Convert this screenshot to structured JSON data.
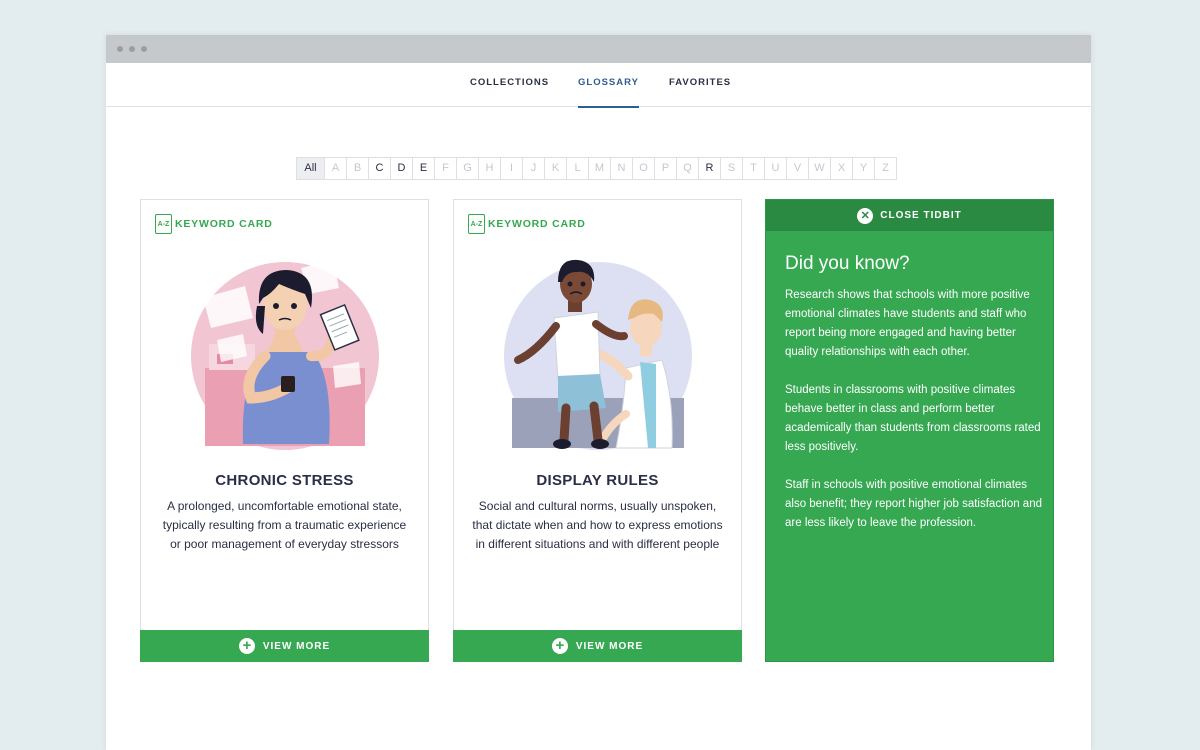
{
  "nav": {
    "tabs": [
      {
        "label": "COLLECTIONS",
        "active": false
      },
      {
        "label": "GLOSSARY",
        "active": true
      },
      {
        "label": "FAVORITES",
        "active": false
      }
    ]
  },
  "alphabet": {
    "all_label": "All",
    "letters": [
      {
        "l": "A",
        "on": false
      },
      {
        "l": "B",
        "on": false
      },
      {
        "l": "C",
        "on": true
      },
      {
        "l": "D",
        "on": true
      },
      {
        "l": "E",
        "on": true
      },
      {
        "l": "F",
        "on": false
      },
      {
        "l": "G",
        "on": false
      },
      {
        "l": "H",
        "on": false
      },
      {
        "l": "I",
        "on": false
      },
      {
        "l": "J",
        "on": false
      },
      {
        "l": "K",
        "on": false
      },
      {
        "l": "L",
        "on": false
      },
      {
        "l": "M",
        "on": false
      },
      {
        "l": "N",
        "on": false
      },
      {
        "l": "O",
        "on": false
      },
      {
        "l": "P",
        "on": false
      },
      {
        "l": "Q",
        "on": false
      },
      {
        "l": "R",
        "on": true
      },
      {
        "l": "S",
        "on": false
      },
      {
        "l": "T",
        "on": false
      },
      {
        "l": "U",
        "on": false
      },
      {
        "l": "V",
        "on": false
      },
      {
        "l": "W",
        "on": false
      },
      {
        "l": "X",
        "on": false
      },
      {
        "l": "Y",
        "on": false
      },
      {
        "l": "Z",
        "on": false
      }
    ]
  },
  "cards": [
    {
      "tag_icon_text": "A-Z",
      "tag_label": "KEYWORD CARD",
      "title": "CHRONIC STRESS",
      "description": "A prolonged, uncomfortable emotional state, typically resulting from a traumatic experience or poor management of everyday stressors",
      "button_label": "VIEW MORE",
      "illustration_icon": "stressed-woman-illustration"
    },
    {
      "tag_icon_text": "A-Z",
      "tag_label": "KEYWORD CARD",
      "title": "DISPLAY RULES",
      "description": "Social and cultural norms, usually unspoken, that dictate when and how to express emotions in different situations and with different people",
      "button_label": "VIEW MORE",
      "illustration_icon": "injured-boy-doctor-illustration"
    }
  ],
  "tidbit": {
    "close_label": "CLOSE TIDBIT",
    "title": "Did you know?",
    "paragraphs": [
      "Research shows that schools with more positive emotional climates have students and staff who report being more engaged and having better quality relationships with each other.",
      "Students in classrooms with positive climates behave better in class and perform better academically than students from classrooms rated less positively.",
      "Staff in schools with positive emotional climates also benefit; they report higher job satisfaction and are less likely to leave the profession."
    ]
  },
  "colors": {
    "accent_green": "#36a852",
    "dark_green": "#2b8a42",
    "nav_active_blue": "#2f5d8f",
    "text_dark": "#2a2f45"
  }
}
